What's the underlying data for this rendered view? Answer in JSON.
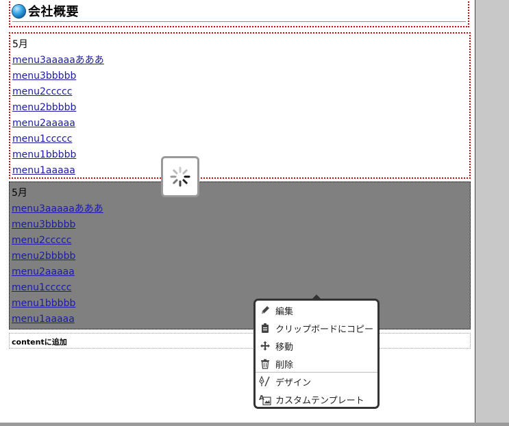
{
  "section": {
    "title": "会社概要"
  },
  "menu_block_1": {
    "month": "5月",
    "links": [
      "menu3aaaaaあああ",
      "menu3bbbbb",
      "menu2ccccc",
      "menu2bbbbb",
      "menu2aaaaa",
      "menu1ccccc",
      "menu1bbbbb",
      "menu1aaaaa"
    ]
  },
  "menu_block_2": {
    "month": "5月",
    "links": [
      "menu3aaaaaあああ",
      "menu3bbbbb",
      "menu2ccccc",
      "menu2bbbbb",
      "menu2aaaaa",
      "menu1ccccc",
      "menu1bbbbb",
      "menu1aaaaa"
    ]
  },
  "add_content_label": "contentに追加",
  "context_menu": {
    "items": [
      {
        "label": "編集",
        "icon": "pencil-icon"
      },
      {
        "label": "クリップボードにコピー",
        "icon": "clipboard-icon"
      },
      {
        "label": "移動",
        "icon": "move-icon"
      },
      {
        "label": "削除",
        "icon": "trash-icon"
      },
      {
        "label": "デザイン",
        "icon": "design-pen-icon"
      },
      {
        "label": "カスタムテンプレート",
        "icon": "custom-template-icon"
      }
    ]
  },
  "colors": {
    "selection_bg": "#808080",
    "link": "#1a1aa6",
    "dotted_border": "#d00000",
    "accent_line": "#3aa7e6"
  }
}
